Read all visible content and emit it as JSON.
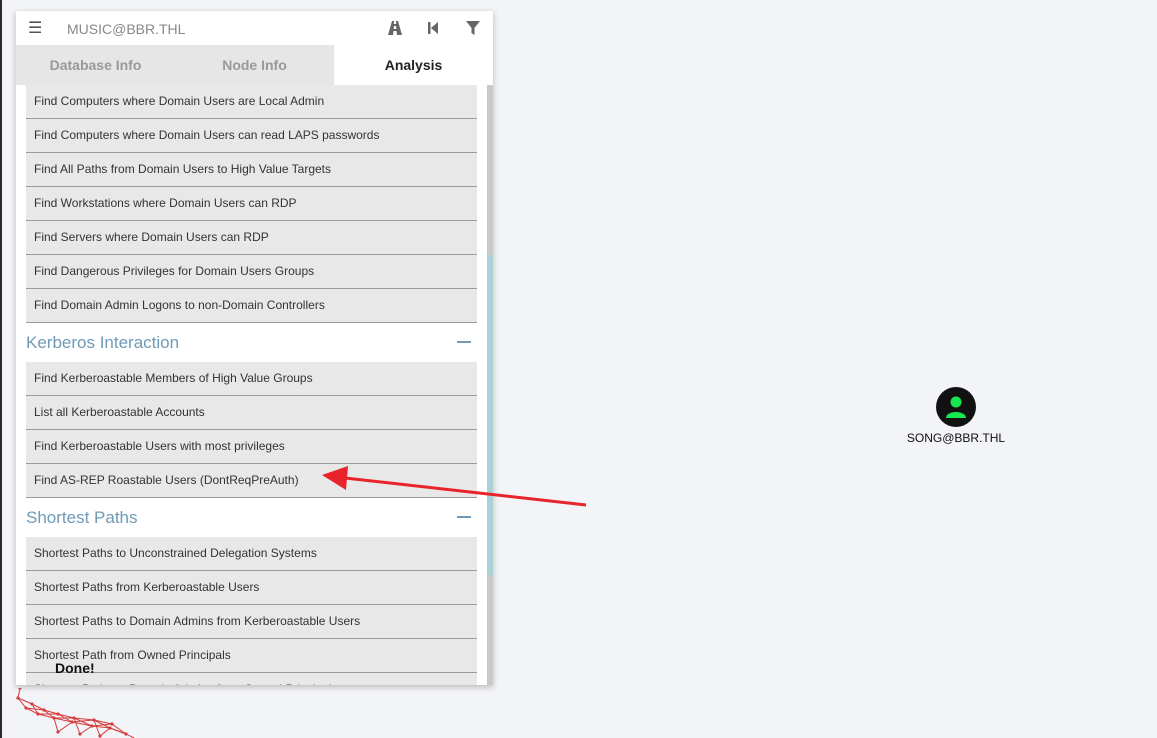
{
  "search": {
    "value": "MUSIC@BBR.THL"
  },
  "toolbar": {
    "menu_icon": "hamburger-icon",
    "pathfinding_icon": "road-icon",
    "back_icon": "step-back-icon",
    "filter_icon": "filter-icon"
  },
  "tabs": [
    {
      "label": "Database Info",
      "active": false
    },
    {
      "label": "Node Info",
      "active": false
    },
    {
      "label": "Analysis",
      "active": true
    }
  ],
  "analysis": {
    "top_items": [
      "Find Computers where Domain Users are Local Admin",
      "Find Computers where Domain Users can read LAPS passwords",
      "Find All Paths from Domain Users to High Value Targets",
      "Find Workstations where Domain Users can RDP",
      "Find Servers where Domain Users can RDP",
      "Find Dangerous Privileges for Domain Users Groups",
      "Find Domain Admin Logons to non-Domain Controllers"
    ],
    "kerberos": {
      "title": "Kerberos Interaction",
      "items": [
        "Find Kerberoastable Members of High Value Groups",
        "List all Kerberoastable Accounts",
        "Find Kerberoastable Users with most privileges",
        "Find AS-REP Roastable Users (DontReqPreAuth)"
      ]
    },
    "shortest": {
      "title": "Shortest Paths",
      "items": [
        "Shortest Paths to Unconstrained Delegation Systems",
        "Shortest Paths from Kerberoastable Users",
        "Shortest Paths to Domain Admins from Kerberoastable Users",
        "Shortest Path from Owned Principals",
        "Shortest Paths to Domain Admins from Owned Principals"
      ]
    }
  },
  "status": {
    "text": "Done!"
  },
  "graph": {
    "node_label": "SONG@BBR.THL",
    "node_icon": "user-icon",
    "node_icon_color": "#17e650"
  },
  "colors": {
    "annotation_arrow": "#e8242a",
    "section_header": "#6f9ab6"
  }
}
